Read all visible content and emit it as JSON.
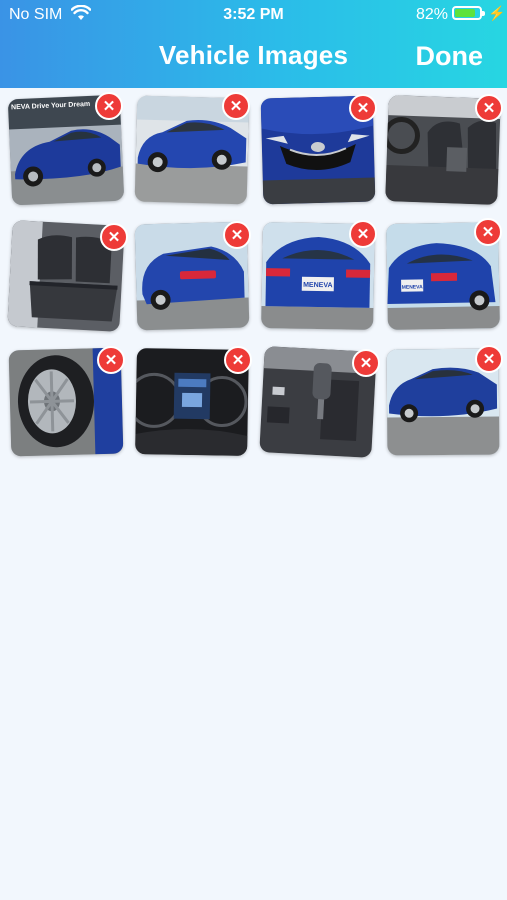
{
  "status_bar": {
    "carrier": "No SIM",
    "time": "3:52 PM",
    "battery_percent": "82%",
    "battery_level": 0.82,
    "wifi_icon": "wifi-icon",
    "charging_icon": "bolt-icon"
  },
  "nav": {
    "title": "Vehicle Images",
    "done_label": "Done"
  },
  "colors": {
    "header_start": "#3a93e6",
    "header_end": "#27d6e2",
    "delete_badge": "#ee3b38",
    "background": "#f2f7fd",
    "car_blue": "#1e3a9a"
  },
  "delete_icon": "close-icon",
  "images": [
    {
      "subject": "front-left exterior",
      "overlay_text": "NEVA  Drive Your Dream"
    },
    {
      "subject": "side exterior"
    },
    {
      "subject": "front grille"
    },
    {
      "subject": "front seats"
    },
    {
      "subject": "rear seats"
    },
    {
      "subject": "rear-left exterior"
    },
    {
      "subject": "rear exterior",
      "overlay_text": "MENEVA"
    },
    {
      "subject": "rear-right exterior",
      "overlay_text": "MENEVA"
    },
    {
      "subject": "wheel"
    },
    {
      "subject": "instrument cluster"
    },
    {
      "subject": "gear shifter"
    },
    {
      "subject": "side exterior"
    }
  ]
}
